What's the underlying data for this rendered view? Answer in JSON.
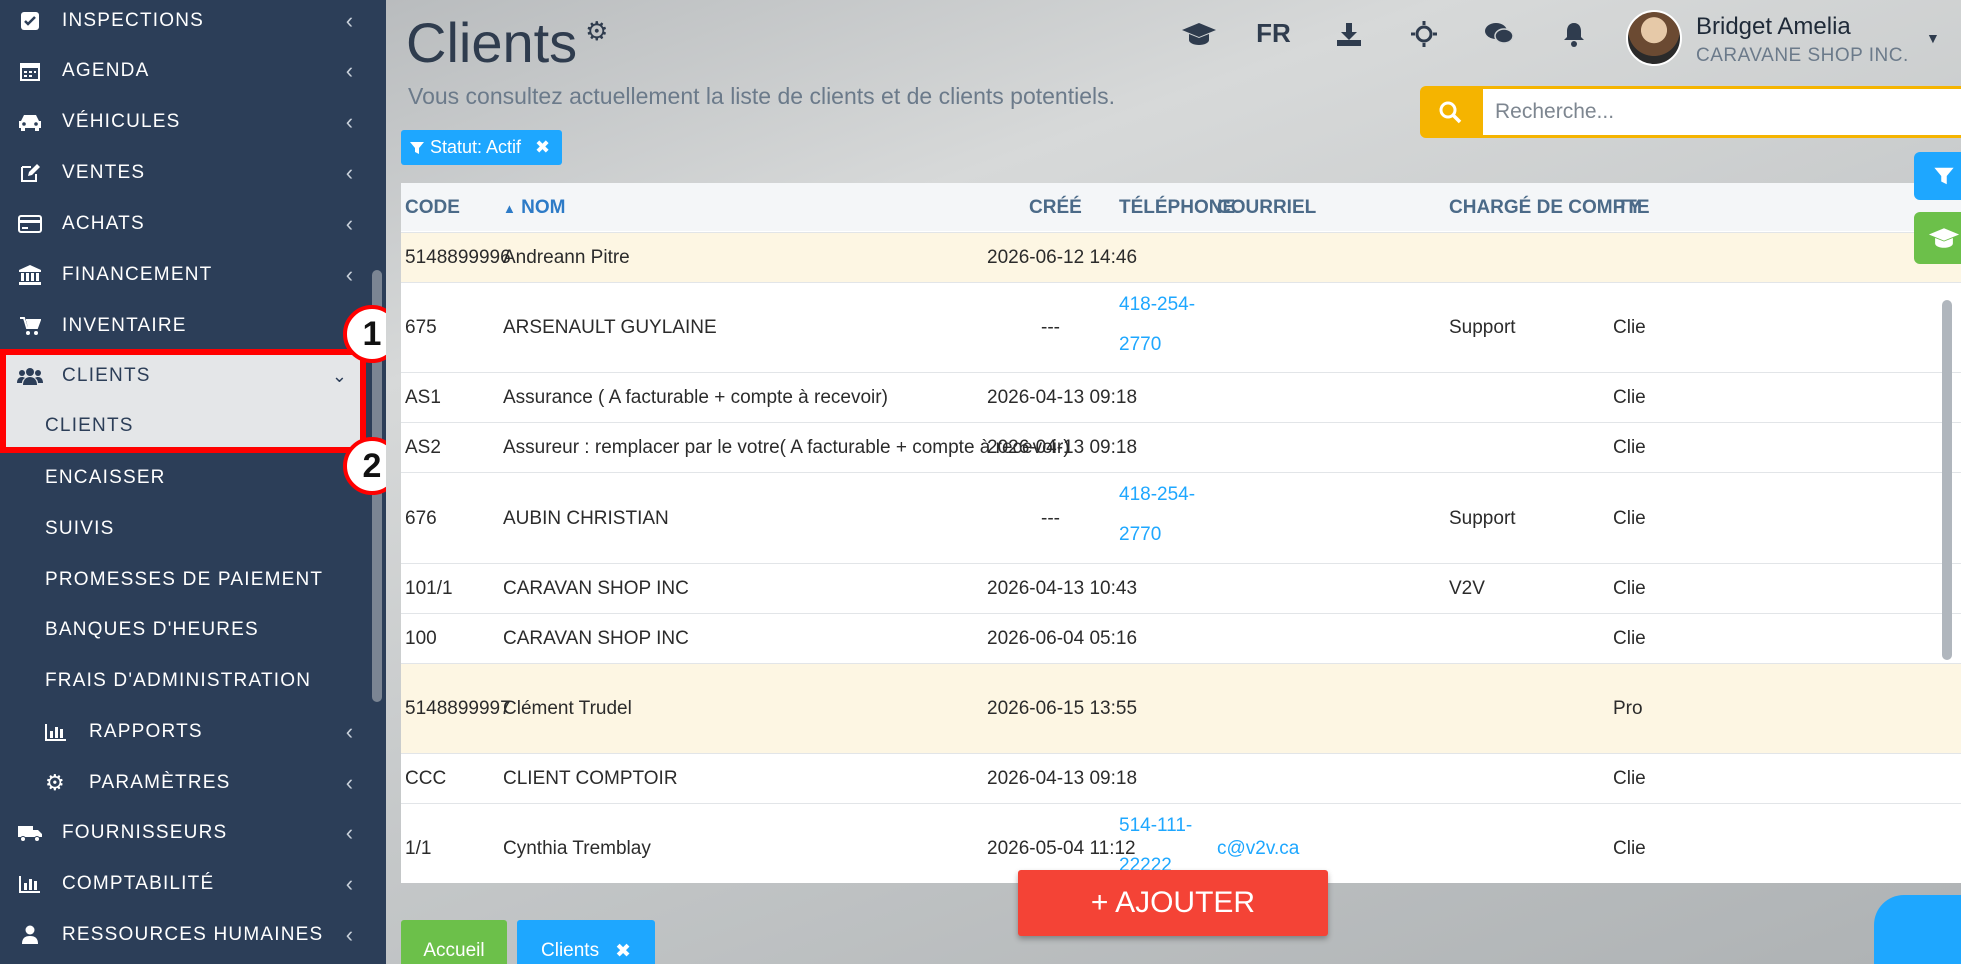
{
  "sidebar": {
    "items": [
      {
        "label": "INSPECTIONS",
        "icon": "check-square-icon"
      },
      {
        "label": "AGENDA",
        "icon": "calendar-icon"
      },
      {
        "label": "VÉHICULES",
        "icon": "car-icon"
      },
      {
        "label": "VENTES",
        "icon": "edit-icon"
      },
      {
        "label": "ACHATS",
        "icon": "credit-card-icon"
      },
      {
        "label": "FINANCEMENT",
        "icon": "bank-icon"
      },
      {
        "label": "INVENTAIRE",
        "icon": "cart-icon"
      },
      {
        "label": "CLIENTS",
        "icon": "users-icon"
      }
    ],
    "sub": [
      "CLIENTS",
      "ENCAISSER",
      "SUIVIS",
      "PROMESSES DE PAIEMENT",
      "BANQUES D'HEURES",
      "FRAIS D'ADMINISTRATION"
    ],
    "sub_icon": [
      {
        "label": "RAPPORTS",
        "icon": "bar-chart-icon"
      },
      {
        "label": "PARAMÈTRES",
        "icon": "gear-icon"
      }
    ],
    "bottom": [
      {
        "label": "FOURNISSEURS",
        "icon": "truck-icon"
      },
      {
        "label": "COMPTABILITÉ",
        "icon": "bar-chart-icon"
      },
      {
        "label": "RESSOURCES HUMAINES",
        "icon": "user-icon"
      }
    ],
    "badges": [
      "1",
      "2"
    ]
  },
  "header": {
    "title": "Clients",
    "subtitle": "Vous consultez actuellement la liste de clients et de clients potentiels.",
    "lang": "FR",
    "user_name": "Bridget Amelia",
    "user_company": "CARAVANE SHOP INC.",
    "search_placeholder": "Recherche...",
    "filter_chip": "Statut: Actif"
  },
  "table": {
    "columns": [
      "CODE",
      "NOM",
      "CRÉÉ",
      "TÉLÉPHONE",
      "COURRIEL",
      "CHARGÉ DE COMPTE",
      "TY"
    ],
    "rows": [
      {
        "code": "5148899996",
        "nom": "Andreann Pitre",
        "cree": "2026-06-12 14:46",
        "tel": "",
        "courriel": "",
        "charge": "",
        "type": ""
      },
      {
        "code": "675",
        "nom": "ARSENAULT GUYLAINE",
        "cree": "---",
        "tel": "418-254-2770",
        "courriel": "",
        "charge": "Support",
        "type": "Clie"
      },
      {
        "code": "AS1",
        "nom": "Assurance ( A facturable + compte à recevoir)",
        "cree": "2026-04-13 09:18",
        "tel": "",
        "courriel": "",
        "charge": "",
        "type": "Clie"
      },
      {
        "code": "AS2",
        "nom": "Assureur : remplacer par le votre( A facturable + compte à recevoir)",
        "cree": "2026-04-13 09:18",
        "tel": "",
        "courriel": "",
        "charge": "",
        "type": "Clie"
      },
      {
        "code": "676",
        "nom": "AUBIN CHRISTIAN",
        "cree": "---",
        "tel": "418-254-2770",
        "courriel": "",
        "charge": "Support",
        "type": "Clie"
      },
      {
        "code": "101/1",
        "nom": "CARAVAN SHOP INC",
        "cree": "2026-04-13 10:43",
        "tel": "",
        "courriel": "",
        "charge": "V2V",
        "type": "Clie"
      },
      {
        "code": "100",
        "nom": "CARAVAN SHOP INC",
        "cree": "2026-06-04 05:16",
        "tel": "",
        "courriel": "",
        "charge": "",
        "type": "Clie"
      },
      {
        "code": "5148899997",
        "nom": "Clément Trudel",
        "cree": "2026-06-15 13:55",
        "tel": "",
        "courriel": "",
        "charge": "",
        "type": "Pro"
      },
      {
        "code": "CCC",
        "nom": "CLIENT COMPTOIR",
        "cree": "2026-04-13 09:18",
        "tel": "",
        "courriel": "",
        "charge": "",
        "type": "Clie"
      },
      {
        "code": "1/1",
        "nom": "Cynthia Tremblay",
        "cree": "2026-05-04 11:12",
        "tel": "514-111-22222",
        "courriel": "c@v2v.ca",
        "charge": "",
        "type": "Clie"
      }
    ]
  },
  "actions": {
    "add_label": "+ AJOUTER",
    "tab_home": "Accueil",
    "tab_clients": "Clients"
  },
  "colors": {
    "sidebar": "#2c3e58",
    "accent_blue": "#1ea7ff",
    "search_yellow": "#f5b400",
    "add_red": "#f44336",
    "highlight_red": "#ff0000",
    "home_green": "#6cc04a"
  }
}
